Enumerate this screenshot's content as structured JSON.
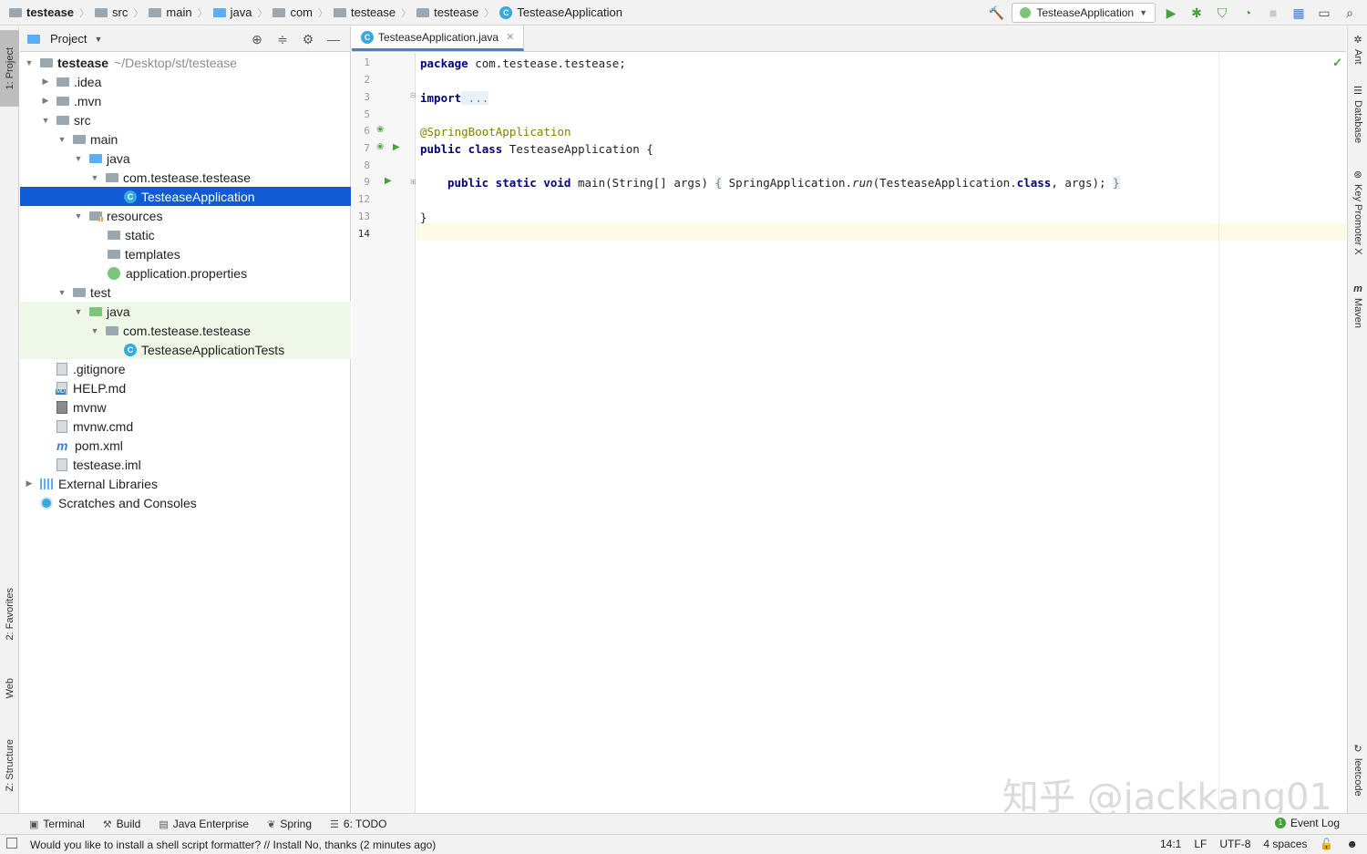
{
  "navbar": {
    "crumbs": [
      "testease",
      "src",
      "main",
      "java",
      "com",
      "testease",
      "testease",
      "TesteaseApplication"
    ],
    "run_config": "TesteaseApplication"
  },
  "left_strip": {
    "project": "1: Project",
    "favorites": "2: Favorites",
    "web": "Web",
    "structure": "Z: Structure"
  },
  "right_strip": {
    "ant": "Ant",
    "database": "Database",
    "key_promoter": "Key Promoter X",
    "maven": "Maven",
    "leetcode": "leetcode"
  },
  "project_panel": {
    "title": "Project",
    "tree": [
      {
        "label": "testease",
        "hint": "~/Desktop/st/testease"
      },
      {
        "label": ".idea"
      },
      {
        "label": ".mvn"
      },
      {
        "label": "src"
      },
      {
        "label": "main"
      },
      {
        "label": "java"
      },
      {
        "label": "com.testease.testease"
      },
      {
        "label": "TesteaseApplication"
      },
      {
        "label": "resources"
      },
      {
        "label": "static"
      },
      {
        "label": "templates"
      },
      {
        "label": "application.properties"
      },
      {
        "label": "test"
      },
      {
        "label": "java"
      },
      {
        "label": "com.testease.testease"
      },
      {
        "label": "TesteaseApplicationTests"
      },
      {
        "label": ".gitignore"
      },
      {
        "label": "HELP.md"
      },
      {
        "label": "mvnw"
      },
      {
        "label": "mvnw.cmd"
      },
      {
        "label": "pom.xml"
      },
      {
        "label": "testease.iml"
      },
      {
        "label": "External Libraries"
      },
      {
        "label": "Scratches and Consoles"
      }
    ]
  },
  "editor": {
    "tab": "TesteaseApplication.java",
    "line_numbers": [
      "1",
      "2",
      "3",
      "5",
      "6",
      "7",
      "8",
      "9",
      "12",
      "13",
      "14"
    ],
    "code": {
      "l1_kw": "package",
      "l1_rest": " com.testease.testease;",
      "l3_kw": "import",
      "l3_fold": " ...",
      "l6_ann": "@SpringBootApplication",
      "l7_kw": "public class",
      "l7_rest": " TesteaseApplication {",
      "l9_kw": "public static void",
      "l9_a": " main(String[] args) ",
      "l9_fold_open": "{",
      "l9_b": " SpringApplication.",
      "l9_run": "run",
      "l9_c": "(TesteaseApplication.",
      "l9_cls": "class",
      "l9_d": ", args); ",
      "l9_fold_close": "}",
      "l13": "}"
    }
  },
  "bottom_tools": {
    "terminal": "Terminal",
    "build": "Build",
    "java_enterprise": "Java Enterprise",
    "spring": "Spring",
    "todo": "6: TODO",
    "event_log": "Event Log"
  },
  "status_bar": {
    "message": "Would you like to install a shell script formatter? // Install    No, thanks (2 minutes ago)",
    "position": "14:1",
    "line_sep": "LF",
    "encoding": "UTF-8",
    "indent": "4 spaces"
  },
  "watermark": "知乎 @jackkang01"
}
